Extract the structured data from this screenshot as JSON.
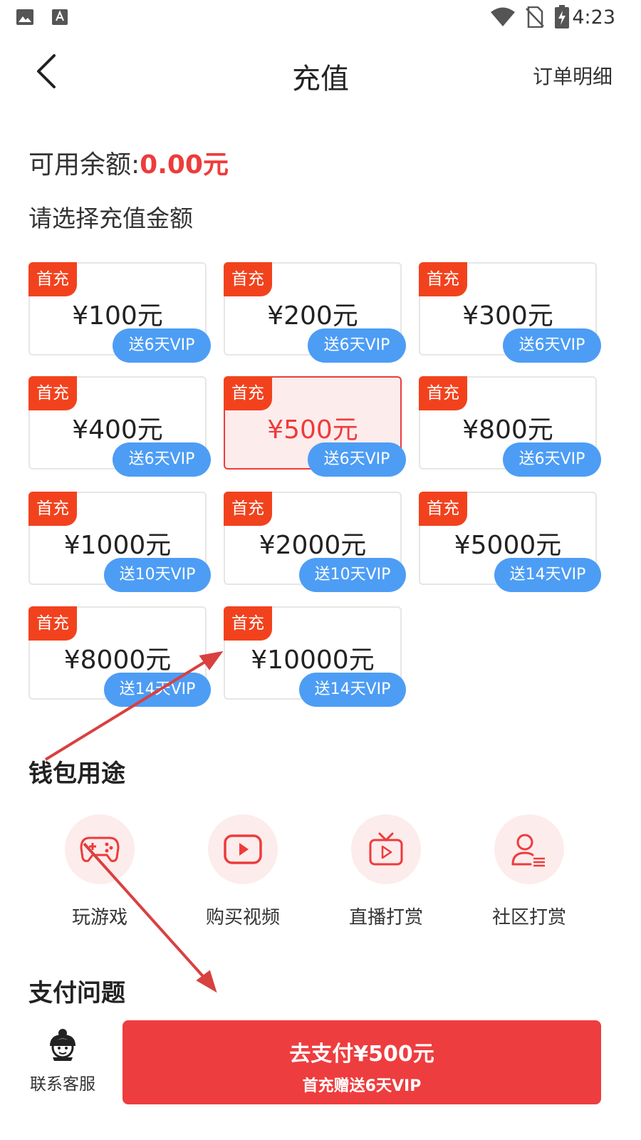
{
  "status": {
    "time": "4:23"
  },
  "nav": {
    "title": "充值",
    "order_link": "订单明细"
  },
  "balance": {
    "label": "可用余额:",
    "amount": "0.00元"
  },
  "choose_label": "请选择充值金额",
  "packages": [
    {
      "tag": "首充",
      "price": "¥100元",
      "gift": "送6天VIP",
      "selected": false
    },
    {
      "tag": "首充",
      "price": "¥200元",
      "gift": "送6天VIP",
      "selected": false
    },
    {
      "tag": "首充",
      "price": "¥300元",
      "gift": "送6天VIP",
      "selected": false
    },
    {
      "tag": "首充",
      "price": "¥400元",
      "gift": "送6天VIP",
      "selected": false
    },
    {
      "tag": "首充",
      "price": "¥500元",
      "gift": "送6天VIP",
      "selected": true
    },
    {
      "tag": "首充",
      "price": "¥800元",
      "gift": "送6天VIP",
      "selected": false
    },
    {
      "tag": "首充",
      "price": "¥1000元",
      "gift": "送10天VIP",
      "selected": false
    },
    {
      "tag": "首充",
      "price": "¥2000元",
      "gift": "送10天VIP",
      "selected": false
    },
    {
      "tag": "首充",
      "price": "¥5000元",
      "gift": "送14天VIP",
      "selected": false
    },
    {
      "tag": "首充",
      "price": "¥8000元",
      "gift": "送14天VIP",
      "selected": false
    },
    {
      "tag": "首充",
      "price": "¥10000元",
      "gift": "送14天VIP",
      "selected": false
    }
  ],
  "wallet": {
    "title": "钱包用途",
    "items": [
      {
        "label": "玩游戏",
        "icon": "gamepad-icon"
      },
      {
        "label": "购买视频",
        "icon": "play-video-icon"
      },
      {
        "label": "直播打赏",
        "icon": "live-tv-icon"
      },
      {
        "label": "社区打赏",
        "icon": "community-user-icon"
      }
    ]
  },
  "pay_issue_title": "支付问题",
  "bottom": {
    "service_label": "联系客服",
    "pay_main": "去支付¥500元",
    "pay_sub": "首充赠送6天VIP"
  },
  "colors": {
    "accent_red": "#ee3b3b",
    "tag_orange": "#f2421d",
    "gift_blue": "#4d9df5",
    "soft_pink": "#fdecec"
  }
}
